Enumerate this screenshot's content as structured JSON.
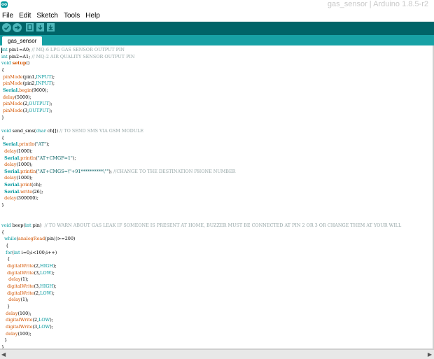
{
  "window": {
    "app_icon_text": "oo",
    "title": "gas_sensor | Arduino 1.8.5-r2"
  },
  "menu": [
    "File",
    "Edit",
    "Sketch",
    "Tools",
    "Help"
  ],
  "toolbar": {
    "buttons": [
      "verify-icon",
      "upload-icon",
      "new-icon",
      "open-icon",
      "save-icon"
    ],
    "color": "#006468",
    "button_color": "#4db7bb"
  },
  "tabs": [
    {
      "label": "gas_sensor"
    }
  ],
  "colors": {
    "keyword": "#00979c",
    "function": "#d35400",
    "comment": "#95a5a6",
    "tab_bar": "#17a1a5"
  },
  "code_lines": [
    [
      [
        "kw",
        "int"
      ],
      [
        "t",
        " pin1=A0; "
      ],
      [
        "cm",
        "// MQ-6 LPG GAS SENSOR OUTPUT PIN"
      ]
    ],
    [
      [
        "kw",
        "int"
      ],
      [
        "t",
        " pin2=A1; "
      ],
      [
        "cm",
        "// MQ-2 AIR QUALITY SENSOR OUTPUT PIN"
      ]
    ],
    [
      [
        "kw",
        "void"
      ],
      [
        "t",
        " "
      ],
      [
        "fnb",
        "setup"
      ],
      [
        "t",
        "()"
      ]
    ],
    [
      [
        "t",
        "{"
      ]
    ],
    [
      [
        "t",
        " "
      ],
      [
        "fn",
        "pinMode"
      ],
      [
        "t",
        "(pin1,"
      ],
      [
        "kw",
        "INPUT"
      ],
      [
        "t",
        ");"
      ]
    ],
    [
      [
        "t",
        " "
      ],
      [
        "fn",
        "pinMode"
      ],
      [
        "t",
        "(pin2,"
      ],
      [
        "kw",
        "INPUT"
      ],
      [
        "t",
        ");"
      ]
    ],
    [
      [
        "t",
        " "
      ],
      [
        "bib",
        "Serial"
      ],
      [
        "t",
        "."
      ],
      [
        "fn",
        "begin"
      ],
      [
        "t",
        "(9600);"
      ]
    ],
    [
      [
        "t",
        " "
      ],
      [
        "fn",
        "delay"
      ],
      [
        "t",
        "(5000);"
      ]
    ],
    [
      [
        "t",
        " "
      ],
      [
        "fn",
        "pinMode"
      ],
      [
        "t",
        "(2,"
      ],
      [
        "kw",
        "OUTPUT"
      ],
      [
        "t",
        ");"
      ]
    ],
    [
      [
        "t",
        " "
      ],
      [
        "fn",
        "pinMode"
      ],
      [
        "t",
        "(3,"
      ],
      [
        "kw",
        "OUTPUT"
      ],
      [
        "t",
        ");"
      ]
    ],
    [
      [
        "t",
        "}"
      ]
    ],
    [
      [
        "t",
        ""
      ]
    ],
    [
      [
        "kw",
        "void"
      ],
      [
        "t",
        " send_sms("
      ],
      [
        "kw",
        "char"
      ],
      [
        "t",
        " ch[]) "
      ],
      [
        "cm",
        "// TO SEND SMS VIA GSM MODULE"
      ]
    ],
    [
      [
        "t",
        "{"
      ]
    ],
    [
      [
        "t",
        " "
      ],
      [
        "bib",
        "Serial"
      ],
      [
        "t",
        "."
      ],
      [
        "fn",
        "println"
      ],
      [
        "t",
        "("
      ],
      [
        "st",
        "\"AT\""
      ],
      [
        "t",
        ");"
      ]
    ],
    [
      [
        "t",
        "  "
      ],
      [
        "fn",
        "delay"
      ],
      [
        "t",
        "(1000);"
      ]
    ],
    [
      [
        "t",
        "  "
      ],
      [
        "bib",
        "Serial"
      ],
      [
        "t",
        "."
      ],
      [
        "fn",
        "println"
      ],
      [
        "t",
        "("
      ],
      [
        "st",
        "\"AT+CMGF=1\""
      ],
      [
        "t",
        ");"
      ]
    ],
    [
      [
        "t",
        "  "
      ],
      [
        "fn",
        "delay"
      ],
      [
        "t",
        "(1000);"
      ]
    ],
    [
      [
        "t",
        "  "
      ],
      [
        "bib",
        "Serial"
      ],
      [
        "t",
        "."
      ],
      [
        "fn",
        "println"
      ],
      [
        "t",
        "("
      ],
      [
        "st",
        "\"AT+CMGS=\\\"+91**********\\\"\""
      ],
      [
        "t",
        "); "
      ],
      [
        "cm",
        "//CHANGE TO THE DESTINATION PHONE NUMBER"
      ]
    ],
    [
      [
        "t",
        "  "
      ],
      [
        "fn",
        "delay"
      ],
      [
        "t",
        "(1000);"
      ]
    ],
    [
      [
        "t",
        "  "
      ],
      [
        "bib",
        "Serial"
      ],
      [
        "t",
        "."
      ],
      [
        "fn",
        "print"
      ],
      [
        "t",
        "(ch);"
      ]
    ],
    [
      [
        "t",
        "  "
      ],
      [
        "bib",
        "Serial"
      ],
      [
        "t",
        "."
      ],
      [
        "fn",
        "write"
      ],
      [
        "t",
        "(26);"
      ]
    ],
    [
      [
        "t",
        "  "
      ],
      [
        "fn",
        "delay"
      ],
      [
        "t",
        "(300000);"
      ]
    ],
    [
      [
        "t",
        "}"
      ]
    ],
    [
      [
        "t",
        ""
      ]
    ],
    [
      [
        "t",
        ""
      ]
    ],
    [
      [
        "kw",
        "void"
      ],
      [
        "t",
        " beep("
      ],
      [
        "kw",
        "int"
      ],
      [
        "t",
        " pin)  "
      ],
      [
        "cm",
        "// TO WARN ABOUT GAS LEAK IF SOMEONE IS PRESENT AT HOME, BUZZER MUST BE CONNECTED AT PIN 2 OR 3 OR CHANGE THEM AT YOUR WILL"
      ]
    ],
    [
      [
        "t",
        "{"
      ]
    ],
    [
      [
        "t",
        "  "
      ],
      [
        "kw",
        "while"
      ],
      [
        "t",
        "("
      ],
      [
        "fn",
        "analogRead"
      ],
      [
        "t",
        "(pin))>=200)"
      ]
    ],
    [
      [
        "t",
        "   {"
      ]
    ],
    [
      [
        "t",
        "   "
      ],
      [
        "kw",
        "for"
      ],
      [
        "t",
        "("
      ],
      [
        "kw",
        "int"
      ],
      [
        "t",
        " i=0;i<100;i++)"
      ]
    ],
    [
      [
        "t",
        "    {"
      ]
    ],
    [
      [
        "t",
        "    "
      ],
      [
        "fn",
        "digitalWrite"
      ],
      [
        "t",
        "(2,"
      ],
      [
        "kw",
        "HIGH"
      ],
      [
        "t",
        ");"
      ]
    ],
    [
      [
        "t",
        "    "
      ],
      [
        "fn",
        "digitalWrite"
      ],
      [
        "t",
        "(3,"
      ],
      [
        "kw",
        "LOW"
      ],
      [
        "t",
        ");"
      ]
    ],
    [
      [
        "t",
        "     "
      ],
      [
        "fn",
        "delay"
      ],
      [
        "t",
        "(1);"
      ]
    ],
    [
      [
        "t",
        "    "
      ],
      [
        "fn",
        "digitalWrite"
      ],
      [
        "t",
        "(3,"
      ],
      [
        "kw",
        "HIGH"
      ],
      [
        "t",
        ");"
      ]
    ],
    [
      [
        "t",
        "    "
      ],
      [
        "fn",
        "digitalWrite"
      ],
      [
        "t",
        "(2,"
      ],
      [
        "kw",
        "LOW"
      ],
      [
        "t",
        ");"
      ]
    ],
    [
      [
        "t",
        "     "
      ],
      [
        "fn",
        "delay"
      ],
      [
        "t",
        "(1);"
      ]
    ],
    [
      [
        "t",
        "    }"
      ]
    ],
    [
      [
        "t",
        "   "
      ],
      [
        "fn",
        "delay"
      ],
      [
        "t",
        "(100);"
      ]
    ],
    [
      [
        "t",
        "   "
      ],
      [
        "fn",
        "digitalWrite"
      ],
      [
        "t",
        "(2,"
      ],
      [
        "kw",
        "LOW"
      ],
      [
        "t",
        ");"
      ]
    ],
    [
      [
        "t",
        "   "
      ],
      [
        "fn",
        "digitalWrite"
      ],
      [
        "t",
        "(3,"
      ],
      [
        "kw",
        "LOW"
      ],
      [
        "t",
        ");"
      ]
    ],
    [
      [
        "t",
        "   "
      ],
      [
        "fn",
        "delay"
      ],
      [
        "t",
        "(100);"
      ]
    ],
    [
      [
        "t",
        "  }"
      ]
    ],
    [
      [
        "t",
        "}"
      ]
    ]
  ]
}
